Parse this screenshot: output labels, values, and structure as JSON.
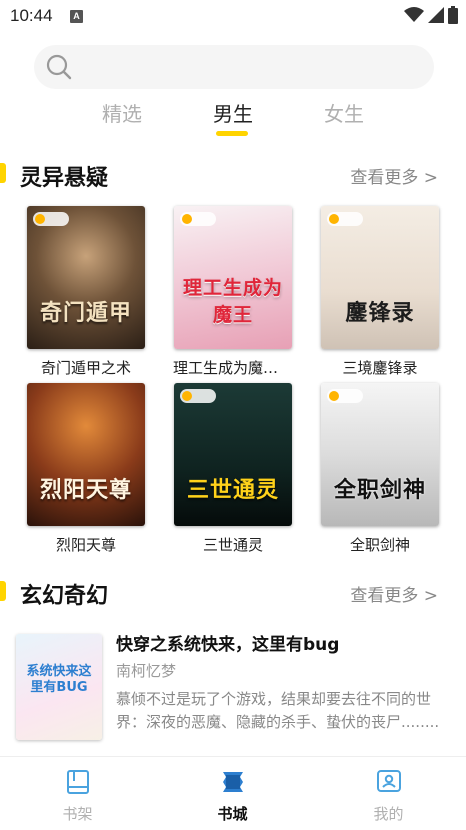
{
  "status": {
    "time": "10:44",
    "notif": "A"
  },
  "search": {
    "placeholder": ""
  },
  "tabs": [
    {
      "label": "精选",
      "active": false
    },
    {
      "label": "男生",
      "active": true
    },
    {
      "label": "女生",
      "active": false
    }
  ],
  "section1": {
    "title": "灵异悬疑",
    "more": "查看更多 >",
    "books": [
      {
        "name": "奇门遁甲之术",
        "cover_text": "奇门遁甲"
      },
      {
        "name": "理工生成为魔王有...",
        "cover_text": "理工生成为魔王"
      },
      {
        "name": "三境鏖锋录",
        "cover_text": "鏖锋录"
      },
      {
        "name": "烈阳天尊",
        "cover_text": "烈阳天尊"
      },
      {
        "name": "三世通灵",
        "cover_text": "三世通灵"
      },
      {
        "name": "全职剑神",
        "cover_text": "全职剑神"
      }
    ]
  },
  "section2": {
    "title": "玄幻奇幻",
    "more": "查看更多 >",
    "items": [
      {
        "title": "快穿之系统快来，这里有bug",
        "author": "南柯忆梦",
        "desc": "慕倾不过是玩了个游戏，结果却要去往不同的世界：深夜的恶魔、隐藏的杀手、蛰伏的丧尸........",
        "cover_text": "系统快来这里有BUG"
      }
    ]
  },
  "nav": [
    {
      "label": "书架",
      "icon": "bookshelf-icon",
      "active": false
    },
    {
      "label": "书城",
      "icon": "bookstore-icon",
      "active": true
    },
    {
      "label": "我的",
      "icon": "profile-icon",
      "active": false
    }
  ],
  "colors": {
    "accent": "#ffd400",
    "text_muted": "#b0b0b0"
  }
}
